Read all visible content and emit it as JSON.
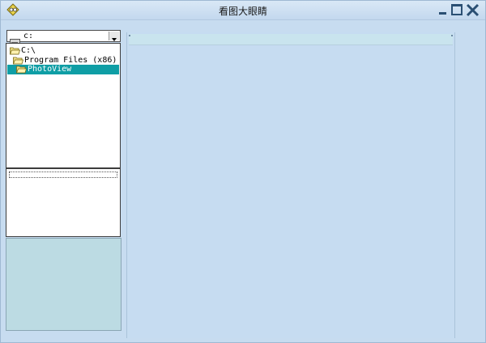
{
  "window": {
    "title": "看图大眼睛",
    "buttons": {
      "minimize": "minimize-icon",
      "maximize": "maximize-icon",
      "close": "close-icon"
    }
  },
  "drive_selector": {
    "value": "c:",
    "icon": "drive-icon"
  },
  "folder_tree": {
    "items": [
      {
        "label": "C:\\",
        "icon": "open-folder-icon",
        "selected": false
      },
      {
        "label": "Program Files (x86)",
        "icon": "open-folder-icon",
        "selected": false
      },
      {
        "label": "PhotoView",
        "icon": "open-folder-icon",
        "selected": true
      }
    ]
  },
  "colors": {
    "background": "#c7dcf0",
    "selection": "#0f9ea5",
    "thumbnail_panel": "#bcdbe3"
  }
}
